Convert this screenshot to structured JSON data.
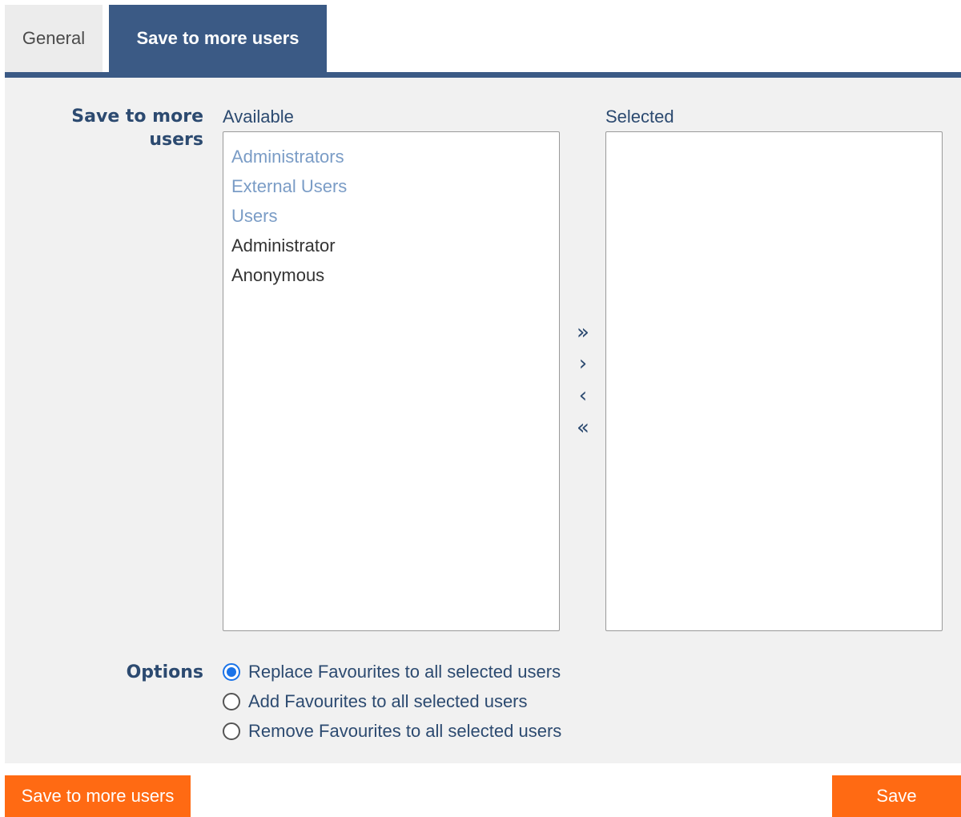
{
  "tabs": [
    {
      "label": "General",
      "active": false
    },
    {
      "label": "Save to more users",
      "active": true
    }
  ],
  "form": {
    "save_label": "Save to more users",
    "available_label": "Available",
    "selected_label": "Selected",
    "available_items": [
      {
        "label": "Administrators",
        "kind": "group"
      },
      {
        "label": "External Users",
        "kind": "group"
      },
      {
        "label": "Users",
        "kind": "group"
      },
      {
        "label": "Administrator",
        "kind": "user"
      },
      {
        "label": "Anonymous",
        "kind": "user"
      }
    ],
    "selected_items": [],
    "move_buttons": {
      "add_all": "»",
      "add": "›",
      "remove": "‹",
      "remove_all": "«"
    },
    "options_label": "Options",
    "options": [
      {
        "label": "Replace Favourites to all selected users",
        "checked": true
      },
      {
        "label": "Add Favourites to all selected users",
        "checked": false
      },
      {
        "label": "Remove Favourites to all selected users",
        "checked": false
      }
    ]
  },
  "footer": {
    "save_more_label": "Save to more users",
    "save_label": "Save"
  },
  "colors": {
    "tab_active": "#3b5a85",
    "label_text": "#2c4a70",
    "group_item": "#7a9cc6",
    "button": "#ff6a13",
    "radio_checked": "#1a73e8"
  }
}
